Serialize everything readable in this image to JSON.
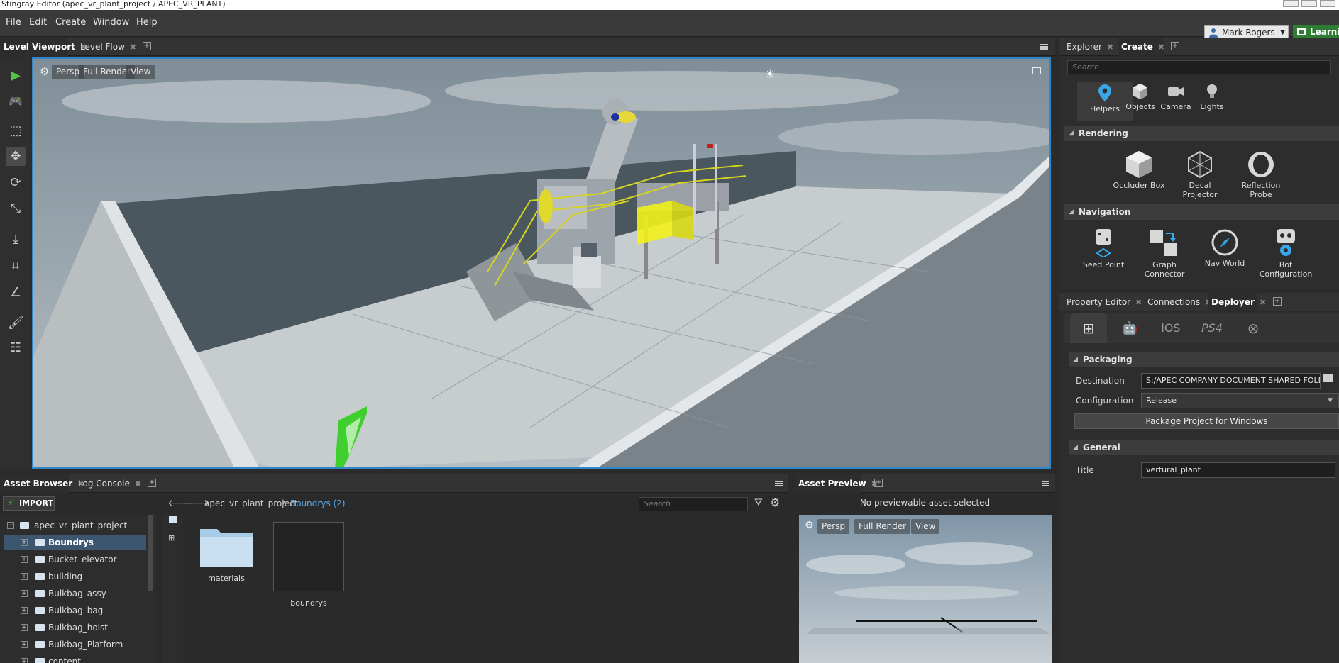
{
  "window": {
    "title": "Stingray Editor (apec_vr_plant_project / APEC_VR_PLANT)"
  },
  "menu": [
    "File",
    "Edit",
    "Create",
    "Window",
    "Help"
  ],
  "user": {
    "name": "Mark Rogers",
    "learning": "Learning"
  },
  "viewport_tabs": [
    {
      "label": "Level Viewport",
      "active": true
    },
    {
      "label": "Level Flow",
      "active": false
    }
  ],
  "viewport": {
    "camera": "Persp",
    "render": "Full Render",
    "view": "View"
  },
  "left_tools": [
    "play-icon",
    "gamepad-icon",
    "select-icon",
    "move-icon",
    "rotate-icon",
    "scale-icon",
    "place-icon",
    "snap-icon",
    "measure-icon",
    "paint-icon",
    "layers-icon"
  ],
  "bottom_tabs": [
    {
      "label": "Asset Browser",
      "active": true
    },
    {
      "label": "Log Console",
      "active": false
    }
  ],
  "asset_browser": {
    "import_label": "IMPORT",
    "breadcrumb_root": "apec_vr_plant_project",
    "breadcrumb_current": "Boundrys (2)",
    "search_placeholder": "Search",
    "tree": [
      {
        "label": "apec_vr_plant_project",
        "level": 0,
        "selected": false
      },
      {
        "label": "Boundrys",
        "level": 1,
        "selected": true
      },
      {
        "label": "Bucket_elevator",
        "level": 1,
        "selected": false
      },
      {
        "label": "building",
        "level": 1,
        "selected": false
      },
      {
        "label": "Bulkbag_assy",
        "level": 1,
        "selected": false
      },
      {
        "label": "Bulkbag_bag",
        "level": 1,
        "selected": false
      },
      {
        "label": "Bulkbag_hoist",
        "level": 1,
        "selected": false
      },
      {
        "label": "Bulkbag_Platform",
        "level": 1,
        "selected": false
      },
      {
        "label": "content",
        "level": 1,
        "selected": false
      }
    ],
    "items": [
      {
        "label": "materials",
        "kind": "folder"
      },
      {
        "label": "boundrys",
        "kind": "asset"
      }
    ]
  },
  "asset_preview": {
    "tab": "Asset Preview",
    "message": "No previewable asset selected",
    "camera": "Persp",
    "render": "Full Render",
    "view": "View"
  },
  "explorer_tabs": [
    {
      "label": "Explorer",
      "active": false
    },
    {
      "label": "Create",
      "active": true
    }
  ],
  "create_panel": {
    "search_placeholder": "Search",
    "top_items": [
      {
        "label": "Helpers",
        "icon": "pin-icon",
        "active": true
      },
      {
        "label": "Objects",
        "icon": "cube-icon",
        "active": false
      },
      {
        "label": "Camera",
        "icon": "camera-icon",
        "active": false
      },
      {
        "label": "Lights",
        "icon": "bulb-icon",
        "active": false
      }
    ],
    "rendering_header": "Rendering",
    "rendering_items": [
      {
        "label": "Occluder Box",
        "icon": "occluder-box-icon"
      },
      {
        "label": "Decal Projector",
        "icon": "decal-projector-icon"
      },
      {
        "label": "Reflection Probe",
        "icon": "reflection-probe-icon"
      }
    ],
    "navigation_header": "Navigation",
    "navigation_items": [
      {
        "label": "Seed Point",
        "icon": "seed-point-icon"
      },
      {
        "label": "Graph Connector",
        "icon": "graph-connector-icon"
      },
      {
        "label": "Nav World",
        "icon": "nav-world-icon"
      },
      {
        "label": "Bot Configuration",
        "icon": "bot-configuration-icon"
      }
    ]
  },
  "property_tabs": [
    {
      "label": "Property Editor",
      "active": false
    },
    {
      "label": "Connections",
      "active": false
    },
    {
      "label": "Deployer",
      "active": true
    }
  ],
  "deployer": {
    "platforms": [
      {
        "label": "",
        "icon": "windows-icon",
        "active": true
      },
      {
        "label": "",
        "icon": "android-icon",
        "active": false
      },
      {
        "label": "iOS",
        "icon": "ios-icon",
        "active": false
      },
      {
        "label": "PS4",
        "icon": "ps4-icon",
        "active": false
      },
      {
        "label": "",
        "icon": "xbox-icon",
        "active": false
      }
    ],
    "packaging_header": "Packaging",
    "destination_label": "Destination",
    "destination_value": "S:/APEC COMPANY DOCUMENT SHARED FOLD",
    "configuration_label": "Configuration",
    "configuration_value": "Release",
    "package_button": "Package Project for Windows",
    "general_header": "General",
    "title_label": "Title",
    "title_value": "vertural_plant"
  },
  "colors": {
    "accent": "#2f86c8",
    "selection": "#3d5670",
    "highlight_yellow": "#f2f21a",
    "import_green": "#4caf50"
  }
}
